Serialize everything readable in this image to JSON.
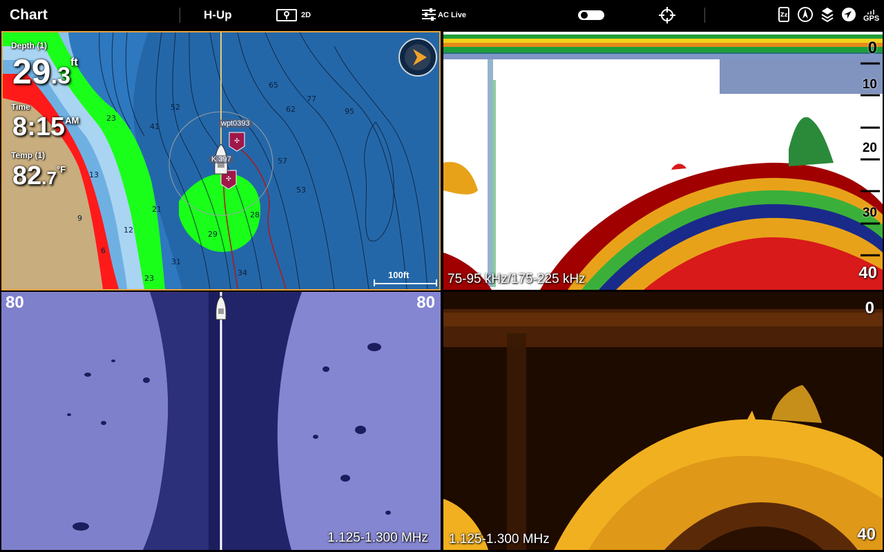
{
  "topbar": {
    "title": "Chart",
    "orientation": "H-Up",
    "view_mode": "2D",
    "ac_live": "AC Live",
    "gps": "GPS",
    "icons": [
      "map-pin-icon",
      "sliders-icon",
      "toggle-icon",
      "crosshair-icon",
      "sleep-icon",
      "compass-rose-icon",
      "layers-icon",
      "navigate-arrow-icon",
      "gps-icon"
    ]
  },
  "chart": {
    "depth_label": "Depth (1)",
    "depth_int": "29",
    "depth_dec": ".3",
    "depth_unit": "ft",
    "time_label": "Time",
    "time_value": "8:15",
    "time_suffix": "AM",
    "temp_label": "Temp (1)",
    "temp_int": "82",
    "temp_dec": ".7",
    "temp_unit": "°F",
    "waypoint_1": "wpt0393",
    "waypoint_2": "K   397",
    "scale": "100ft",
    "contour_labels": [
      "65",
      "62",
      "77",
      "95",
      "53",
      "52",
      "41",
      "57",
      "28",
      "29",
      "23",
      "13",
      "12",
      "9",
      "6",
      "21",
      "31",
      "34",
      "23"
    ]
  },
  "sonar": {
    "depth_scale": [
      "0",
      "10",
      "20",
      "30",
      "40"
    ],
    "frequency": "75-95 kHz/175-225 kHz"
  },
  "side_imaging": {
    "range_left": "80",
    "range_right": "80",
    "frequency": "1.125-1.300 MHz"
  },
  "down_imaging": {
    "depth_top": "0",
    "depth_bottom": "40",
    "frequency": "1.125-1.300 MHz"
  },
  "colors": {
    "chart_border": "#e8a33b",
    "water_deep": "#2467a8",
    "shallow_green": "#1aff1a",
    "shore_red": "#ff1a1a",
    "land": "#c8ad7f",
    "down_imaging_yellow": "#f0b020",
    "side_imaging_blue": "#8f8fd6"
  }
}
